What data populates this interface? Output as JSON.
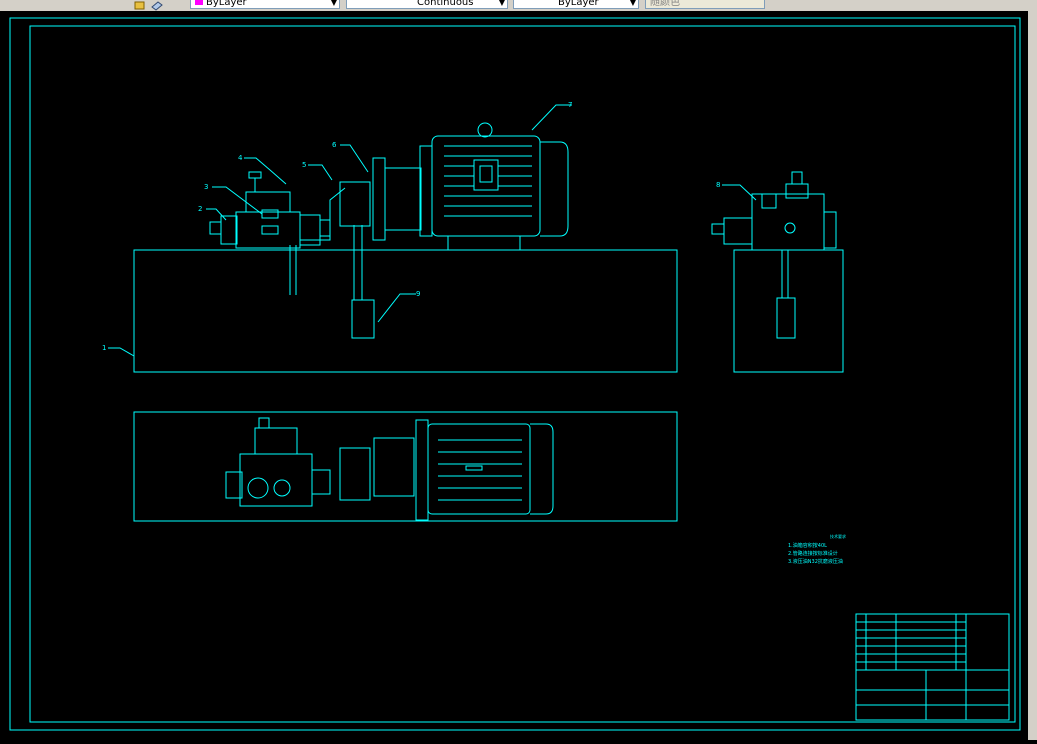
{
  "toolbar": {
    "layer_value": "ByLayer",
    "linetype_value": "Continuous",
    "lineweight_value": "ByLayer",
    "plotstyle_value": "随颜色"
  },
  "colors": {
    "line": "#00ffff",
    "background": "#000000",
    "toolbar": "#d4d0c8"
  },
  "callouts": [
    "1",
    "2",
    "3",
    "4",
    "5",
    "6",
    "7",
    "8",
    "9"
  ],
  "notes": {
    "title": "技术要求",
    "lines": [
      "1.油箱容积按40L",
      "2.管路连接按标准设计",
      "3.液压油N32抗磨液压油"
    ]
  }
}
